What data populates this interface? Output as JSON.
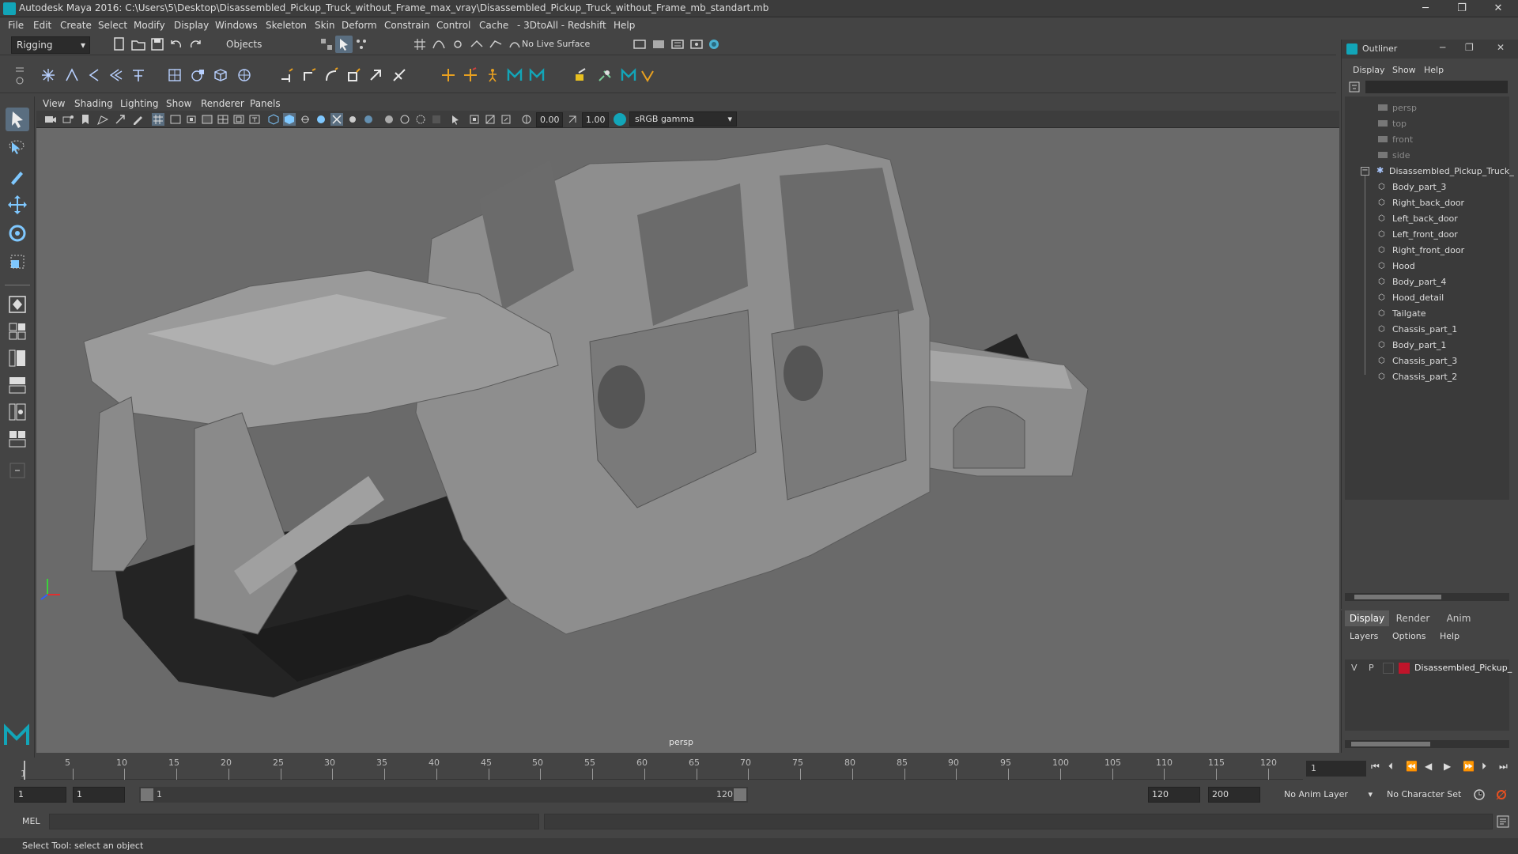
{
  "window": {
    "title": "Autodesk Maya 2016: C:\\Users\\5\\Desktop\\Disassembled_Pickup_Truck_without_Frame_max_vray\\Disassembled_Pickup_Truck_without_Frame_mb_standart.mb",
    "minimize": "─",
    "maximize": "❐",
    "close": "✕"
  },
  "menubar": [
    "File",
    "Edit",
    "Create",
    "Select",
    "Modify",
    "Display",
    "Windows",
    "Skeleton",
    "Skin",
    "Deform",
    "Constrain",
    "Control",
    "Cache",
    "- 3DtoAll -",
    "Redshift",
    "Help"
  ],
  "statusline": {
    "menu_set": "Rigging",
    "selection_mode": "Objects",
    "live_surface": "No Live Surface"
  },
  "panel": {
    "menus": [
      "View",
      "Shading",
      "Lighting",
      "Show",
      "Renderer",
      "Panels"
    ],
    "exposure": "0.00",
    "gamma": "1.00",
    "color_space": "sRGB gamma",
    "camera_label": "persp"
  },
  "timeline": {
    "ticks": [
      "5",
      "10",
      "15",
      "20",
      "25",
      "30",
      "35",
      "40",
      "45",
      "50",
      "55",
      "60",
      "65",
      "70",
      "75",
      "80",
      "85",
      "90",
      "95",
      "100",
      "105",
      "110",
      "115",
      "120"
    ],
    "start_label": "1",
    "current_frame": "1"
  },
  "range": {
    "start": "1",
    "playback_start": "1",
    "slider_start": "1",
    "slider_end": "120",
    "playback_end": "120",
    "end": "200",
    "anim_layer": "No Anim Layer",
    "character_set": "No Character Set"
  },
  "cmdline": {
    "label": "MEL"
  },
  "helpline": {
    "text": "Select Tool: select an object"
  },
  "outliner": {
    "title": "Outliner",
    "menus": [
      "Display",
      "Show",
      "Help"
    ],
    "cameras": [
      "persp",
      "top",
      "front",
      "side"
    ],
    "group": "Disassembled_Pickup_Truck_",
    "children": [
      "Body_part_3",
      "Right_back_door",
      "Left_back_door",
      "Left_front_door",
      "Right_front_door",
      "Hood",
      "Body_part_4",
      "Hood_detail",
      "Tailgate",
      "Chassis_part_1",
      "Body_part_1",
      "Chassis_part_3",
      "Chassis_part_2"
    ]
  },
  "layers": {
    "tabs": [
      "Display",
      "Render",
      "Anim"
    ],
    "menus": [
      "Layers",
      "Options",
      "Help"
    ],
    "layer_v": "V",
    "layer_p": "P",
    "layer_name": "Disassembled_Pickup_",
    "layer_color": "#c0142a"
  }
}
